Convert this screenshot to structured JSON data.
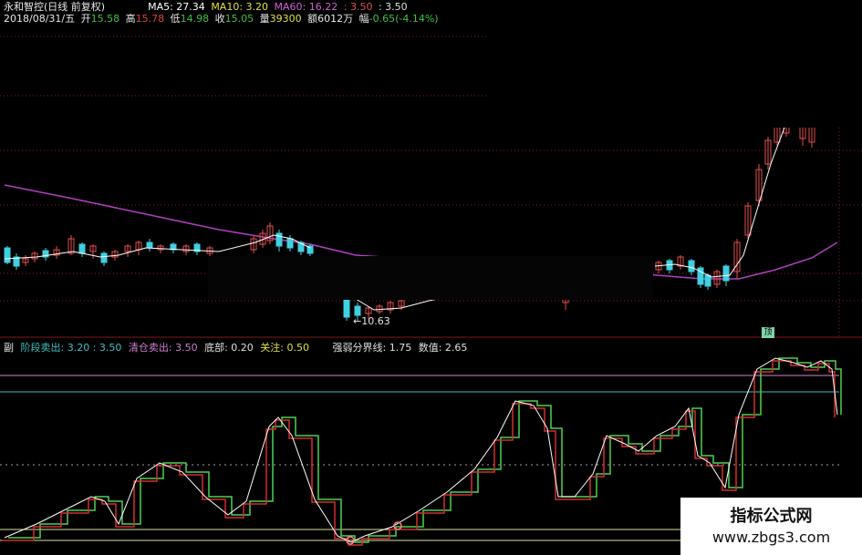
{
  "header": {
    "title": "永和智控(日线 前复权)",
    "masked_name": "",
    "ma5": "MA5: 27.34",
    "ma10": "MA10: 3.20",
    "ma60": "MA60: 16.22",
    "extra1": ": 3.50",
    "extra2": ": 3.50",
    "date": "2018/08/31/五",
    "open_label": "开",
    "open_value": "15.58",
    "high_label": "高",
    "high_value": "15.78",
    "low_label": "低",
    "low_value": "14.98",
    "close_label": "收",
    "close_value": "15.05",
    "volume_label": "量",
    "volume_value": "39300",
    "amount_label": "额",
    "amount_value": "6012万",
    "change_label": "幅",
    "change_value": "-0.65(-4.14%)"
  },
  "price_chart": {
    "low_annotation": "10.63",
    "badge": "顶"
  },
  "indicator_bar": {
    "prefix": "副",
    "stage_sell": "阶段卖出: 3.20 : 3.50",
    "clear_sell": "清仓卖出: 3.50",
    "bottom": "底部: 0.20",
    "focus": "关注: 0.50",
    "strength_line": "强弱分界线: 1.75",
    "value": "数值: 2.65"
  },
  "watermark": {
    "line1": "指标公式网",
    "line2": "www.zbgs3.com"
  },
  "colors": {
    "background": "#000000",
    "up": "#e05050",
    "down": "#40d0e0",
    "ma_white": "#ffffff",
    "ma_purple": "#b040c0",
    "ind_red": "#d03030",
    "ind_green": "#50d050",
    "line_magenta": "#d080d0",
    "line_cyan": "#40c0c0",
    "line_yellow": "#e0e0a0",
    "grid_red": "#802020"
  }
}
